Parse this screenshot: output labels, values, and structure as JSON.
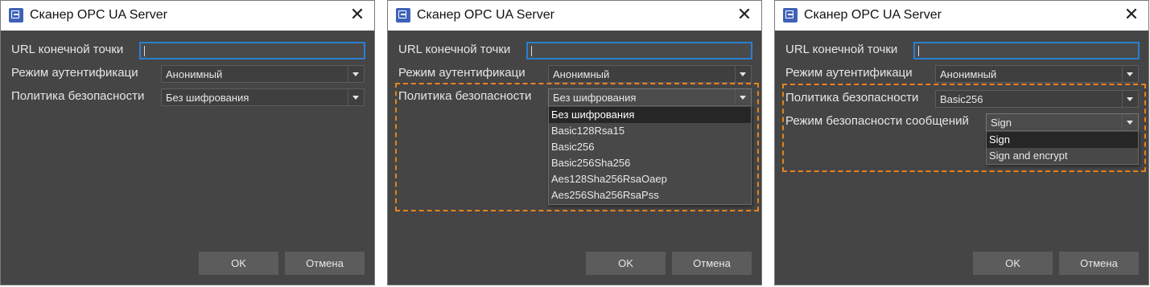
{
  "dialog_title": "Сканер OPC UA Server",
  "close_glyph": "✕",
  "labels": {
    "url": "URL конечной точки",
    "auth_mode": "Режим аутентификаци",
    "security_policy": "Политика безопасности",
    "message_security_mode": "Режим безопасности сообщений"
  },
  "values": {
    "url": "",
    "auth_mode": "Анонимный",
    "security_policy_none": "Без шифрования",
    "security_policy_basic256": "Basic256",
    "message_security_mode": "Sign"
  },
  "security_policy_options": [
    "Без шифрования",
    "Basic128Rsa15",
    "Basic256",
    "Basic256Sha256",
    "Aes128Sha256RsaOaep",
    "Aes256Sha256RsaPss"
  ],
  "message_security_mode_options": [
    "Sign",
    "Sign and encrypt"
  ],
  "buttons": {
    "ok": "OK",
    "cancel": "Отмена"
  },
  "icons": {
    "app": "app-window-icon",
    "close": "close-icon",
    "dropdown": "chevron-down-icon"
  },
  "colors": {
    "dialog_bg": "#454545",
    "focus_border": "#2a7fd1",
    "highlight_frame": "#e8821e",
    "selected_item_bg": "#262626"
  }
}
